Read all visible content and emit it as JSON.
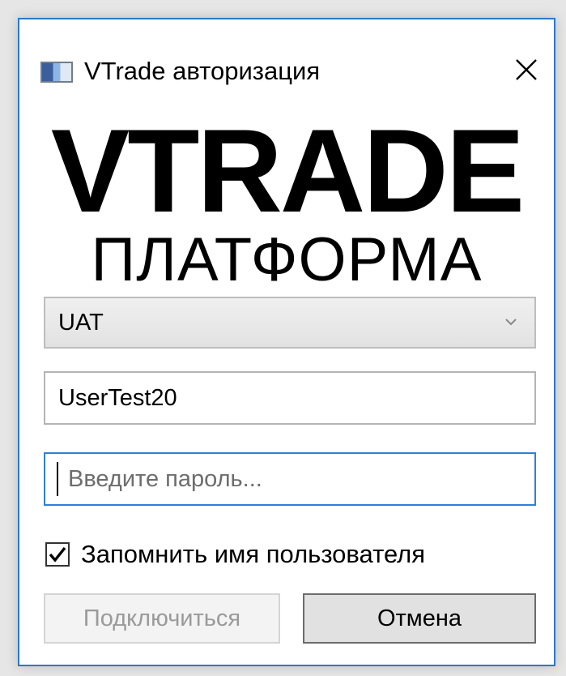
{
  "window": {
    "title": "VTrade авторизация",
    "accent_color": "#2b78c9"
  },
  "logo": {
    "main": "VTRADE",
    "sub": "ПЛАТФОРМА"
  },
  "environment": {
    "selected": "UAT"
  },
  "username": {
    "value": "UserTest20"
  },
  "password": {
    "value": "",
    "placeholder": "Введите пароль..."
  },
  "remember": {
    "label": "Запомнить имя пользователя",
    "checked": true
  },
  "buttons": {
    "connect_label": "Подключиться",
    "connect_enabled": false,
    "cancel_label": "Отмена"
  },
  "icons": {
    "app": "app-window-icon",
    "close": "close-icon",
    "dropdown": "chevron-down-icon",
    "check": "checkmark-icon"
  }
}
